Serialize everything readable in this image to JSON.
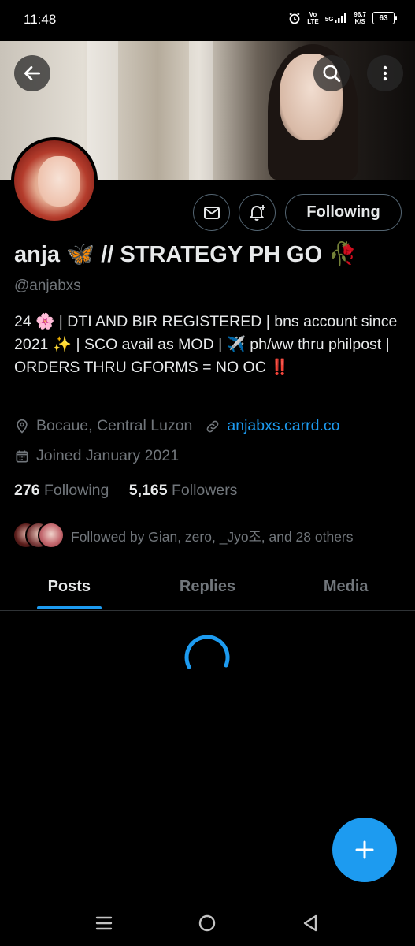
{
  "status_bar": {
    "time": "11:48",
    "network_top": "Vo",
    "network_bottom": "LTE",
    "signal_label": "5G",
    "speed_value": "96.7",
    "speed_unit": "K/S",
    "battery": "63"
  },
  "profile": {
    "display_name": "anja 🦋 // STRATEGY PH GO 🥀",
    "handle": "@anjabxs",
    "bio": "24 🌸 | DTI AND BIR REGISTERED | bns account since 2021 ✨ | SCO avail as MOD | ✈️ ph/ww thru philpost | ORDERS THRU GFORMS = NO OC ‼️",
    "location": "Bocaue, Central Luzon",
    "website": "anjabxs.carrd.co",
    "joined": "Joined January 2021",
    "following_count": "276",
    "following_label": "Following",
    "followers_count": "5,165",
    "followers_label": "Followers",
    "followed_by": "Followed by Gian, zero, _Jyo조, and 28 others"
  },
  "actions": {
    "following_button": "Following"
  },
  "tabs": [
    {
      "label": "Posts",
      "active": true
    },
    {
      "label": "Replies",
      "active": false
    },
    {
      "label": "Media",
      "active": false
    }
  ],
  "icons": [
    "back-arrow-icon",
    "search-icon",
    "more-vertical-icon",
    "mail-icon",
    "notification-bell-icon",
    "location-pin-icon",
    "link-icon",
    "calendar-icon",
    "plus-icon",
    "menu-icon",
    "home-circle-icon",
    "back-triangle-icon"
  ],
  "colors": {
    "accent": "#1d9bf0",
    "background": "#000000",
    "muted_text": "#71767b",
    "primary_text": "#e7e9ea"
  }
}
